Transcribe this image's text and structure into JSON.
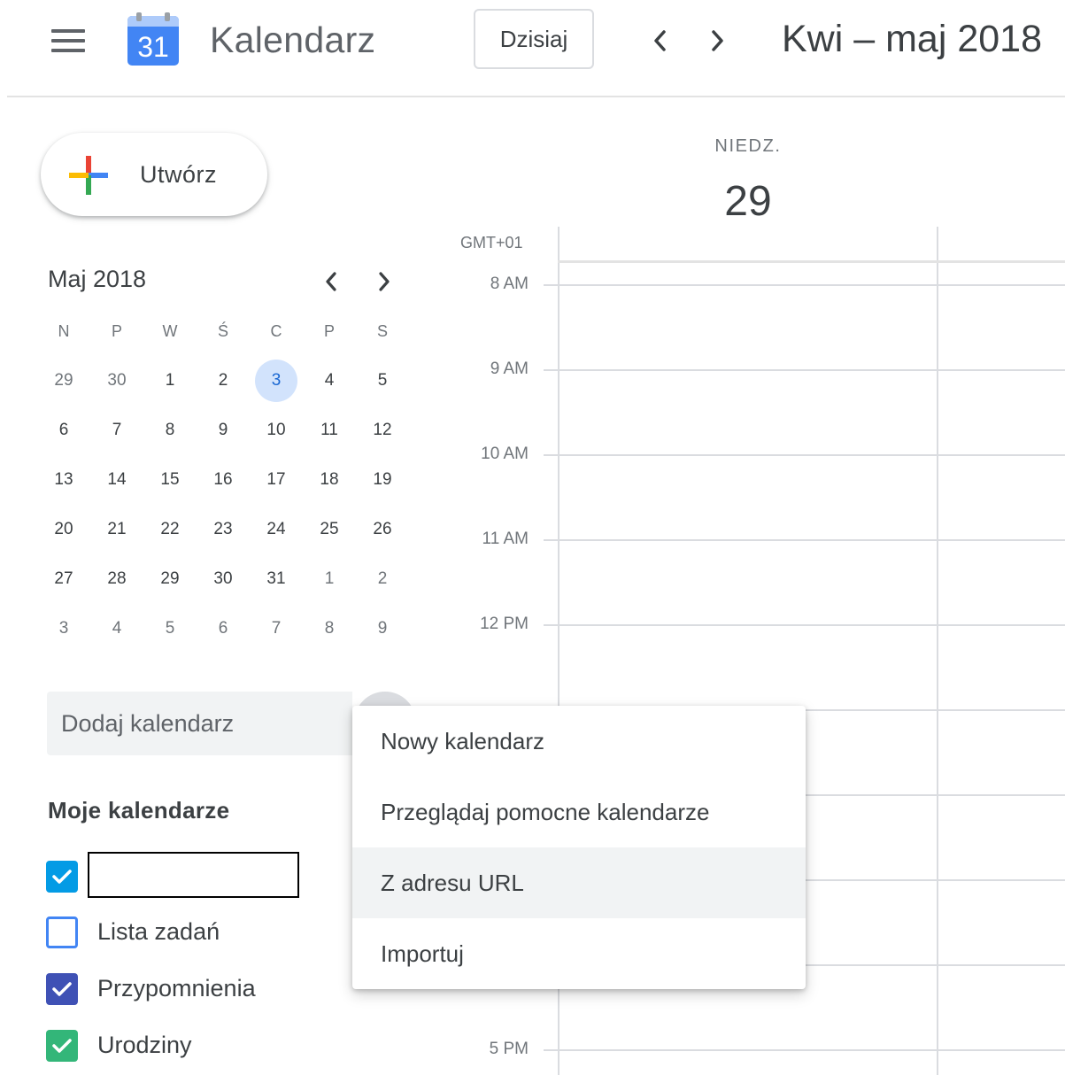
{
  "header": {
    "app_title": "Kalendarz",
    "logo_number": "31",
    "today_label": "Dzisiaj",
    "date_range": "Kwi – maj 2018",
    "icons": {
      "menu": "hamburger-menu-icon",
      "prev": "chevron-left-icon",
      "next": "chevron-right-icon"
    }
  },
  "create": {
    "label": "Utwórz"
  },
  "mini_calendar": {
    "title": "Maj 2018",
    "weekdays": [
      "N",
      "P",
      "W",
      "Ś",
      "C",
      "P",
      "S"
    ],
    "weeks": [
      [
        "29",
        "30",
        "1",
        "2",
        "3",
        "4",
        "5"
      ],
      [
        "6",
        "7",
        "8",
        "9",
        "10",
        "11",
        "12"
      ],
      [
        "13",
        "14",
        "15",
        "16",
        "17",
        "18",
        "19"
      ],
      [
        "20",
        "21",
        "22",
        "23",
        "24",
        "25",
        "26"
      ],
      [
        "27",
        "28",
        "29",
        "30",
        "31",
        "1",
        "2"
      ],
      [
        "3",
        "4",
        "5",
        "6",
        "7",
        "8",
        "9"
      ]
    ],
    "highlighted_day": "3"
  },
  "add_calendar": {
    "placeholder": "Dodaj kalendarz"
  },
  "my_calendars": {
    "title": "Moje kalendarze",
    "items": [
      {
        "label": "",
        "checked": true,
        "color": "#039be5"
      },
      {
        "label": "Lista zadań",
        "checked": false,
        "color": "#4285f4"
      },
      {
        "label": "Przypomnienia",
        "checked": true,
        "color": "#3f51b5"
      },
      {
        "label": "Urodziny",
        "checked": true,
        "color": "#33b679"
      }
    ]
  },
  "day_view": {
    "day_name": "NIEDZ.",
    "day_number": "29",
    "timezone": "GMT+01",
    "hours": [
      "8 AM",
      "9 AM",
      "10 AM",
      "11 AM",
      "12 PM",
      "5 PM"
    ]
  },
  "menu": {
    "items": [
      {
        "label": "Nowy kalendarz"
      },
      {
        "label": "Przeglądaj pomocne kalendarze"
      },
      {
        "label": "Z adresu URL"
      },
      {
        "label": "Importuj"
      }
    ],
    "hovered_index": 2
  },
  "colors": {
    "accent": "#1a73e8",
    "today_highlight_bg": "#d2e3fc",
    "logo_blue": "#4285f4"
  }
}
